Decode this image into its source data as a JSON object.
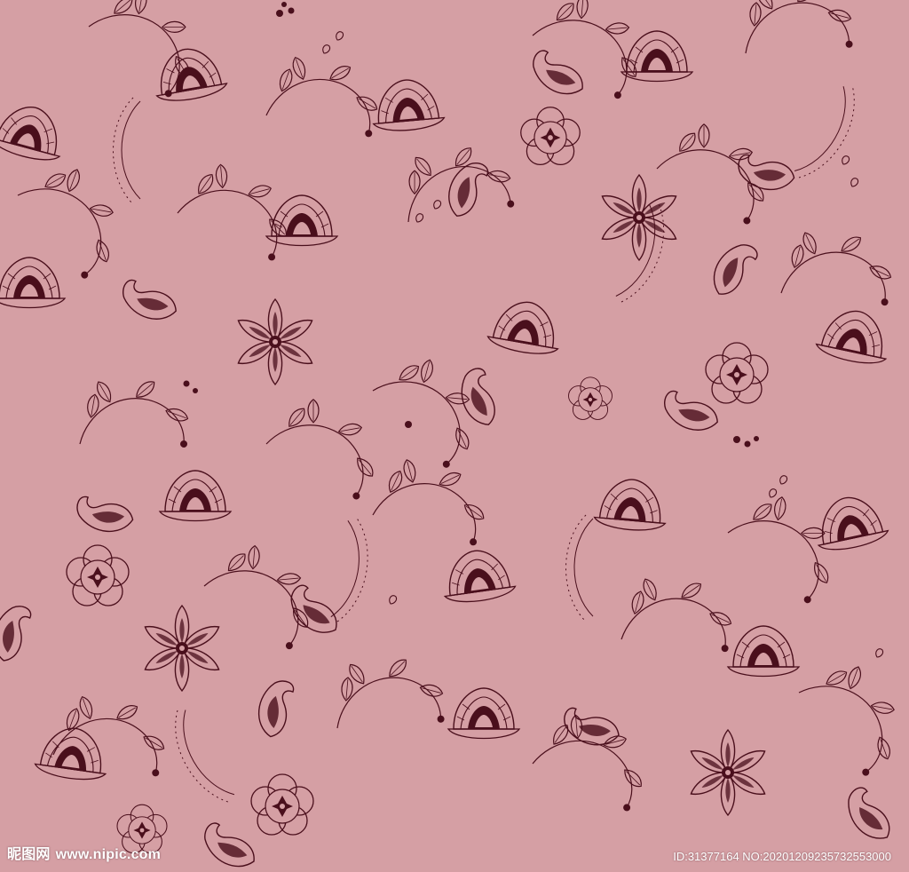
{
  "watermark": {
    "brand_cn": "昵图网",
    "brand_url": "www.nipic.com",
    "id_text": "ID:31377164 NO:20201209235732553000"
  },
  "colors": {
    "background": "#d59fa4",
    "ink": "#4a0f1c",
    "watermark_text": "#ffffff"
  },
  "motifs": [
    {
      "kind": "flower-pink",
      "count_hint": "five-petal"
    },
    {
      "kind": "flower-star",
      "count_hint": "six-petal"
    },
    {
      "kind": "flower-rosette",
      "count_hint": "four-petal"
    },
    {
      "kind": "flower-lotus",
      "count_hint": "fan"
    },
    {
      "kind": "paisley-leaf",
      "count_hint": "single"
    },
    {
      "kind": "vine-branch",
      "count_hint": "curved"
    }
  ]
}
